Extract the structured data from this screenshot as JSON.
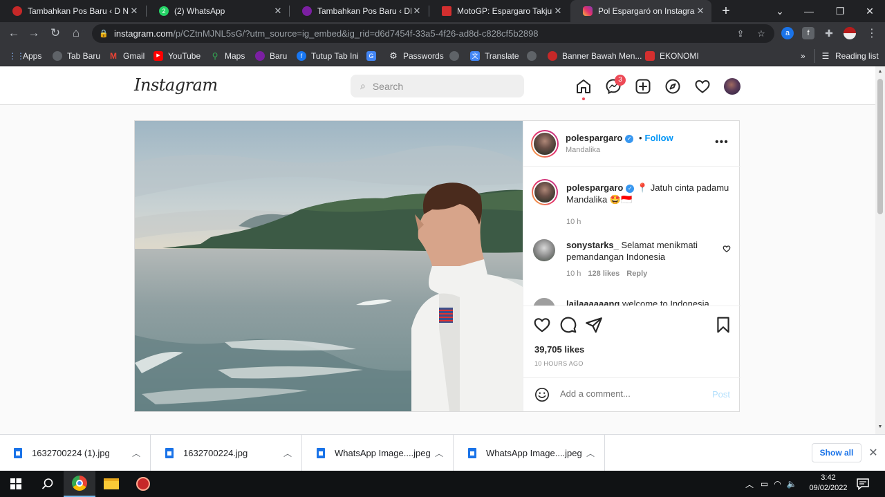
{
  "browser": {
    "tabs": [
      {
        "title": "Tambahkan Pos Baru ‹ D News",
        "favicon_color": "#c62828"
      },
      {
        "title": "(2) WhatsApp",
        "favicon_color": "#25d366",
        "favicon_text": "2"
      },
      {
        "title": "Tambahkan Pos Baru ‹ DRadio",
        "favicon_color": "#7b1fa2"
      },
      {
        "title": "MotoGP: Espargaro Takjub Li",
        "favicon_color": "#d32f2f"
      },
      {
        "title": "Pol Espargaró on Instagram:",
        "favicon_color": "#e1306c",
        "active": true
      }
    ],
    "url": {
      "host": "instagram.com",
      "path": "/p/CZtnMJNL5sG/?utm_source=ig_embed&ig_rid=d6d7454f-33a5-4f26-ad8d-c828cf5b2898"
    },
    "bookmarks": [
      {
        "label": "Apps",
        "icon": "apps-grid-icon",
        "color": "#8ab4f8"
      },
      {
        "label": "Tab Baru",
        "icon": "globe-icon",
        "color": "#5f6368"
      },
      {
        "label": "Gmail",
        "icon": "gmail-icon",
        "color": "#ea4335"
      },
      {
        "label": "YouTube",
        "icon": "youtube-icon",
        "color": "#ff0000"
      },
      {
        "label": "Maps",
        "icon": "maps-icon",
        "color": "#34a853"
      },
      {
        "label": "Baru",
        "icon": "site-icon",
        "color": "#7b1fa2"
      },
      {
        "label": "Tutup Tab Ini",
        "icon": "facebook-icon",
        "color": "#1877f2"
      },
      {
        "label": "",
        "icon": "google-icon",
        "color": "#4285f4"
      },
      {
        "label": "Passwords",
        "icon": "gear-icon",
        "color": "#9aa0a6"
      },
      {
        "label": "",
        "icon": "globe-icon",
        "color": "#5f6368"
      },
      {
        "label": "Translate",
        "icon": "translate-icon",
        "color": "#4285f4"
      },
      {
        "label": "",
        "icon": "globe-icon",
        "color": "#5f6368"
      },
      {
        "label": "Banner Bawah Men...",
        "icon": "site-icon",
        "color": "#c62828"
      },
      {
        "label": "EKONOMI",
        "icon": "site-icon",
        "color": "#d32f2f"
      }
    ],
    "more_bookmarks": "»",
    "reading_list": "Reading list"
  },
  "instagram": {
    "logo": "Instagram",
    "search_placeholder": "Search",
    "messages_badge": "3",
    "post": {
      "username": "polespargaro",
      "follow": "Follow",
      "dot": "•",
      "location": "Mandalika",
      "caption_text": "📍 Jatuh cinta padamu Mandalika 🤩🇮🇩",
      "caption_time": "10 h",
      "comments": [
        {
          "username": "sonystarks_",
          "text": "Selamat menikmati pemandangan Indonesia",
          "time": "10 h",
          "likes": "128 likes",
          "reply": "Reply"
        },
        {
          "username": "lailaaaaaang",
          "text": "welcome to Indonesia"
        }
      ],
      "likes": "39,705 likes",
      "time_ago": "10 HOURS AGO",
      "comment_placeholder": "Add a comment...",
      "post_button": "Post"
    }
  },
  "downloads": {
    "items": [
      "1632700224 (1).jpg",
      "1632700224.jpg",
      "WhatsApp Image....jpeg",
      "WhatsApp Image....jpeg"
    ],
    "show_all": "Show all"
  },
  "taskbar": {
    "time": "3:42",
    "date": "09/02/2022"
  }
}
